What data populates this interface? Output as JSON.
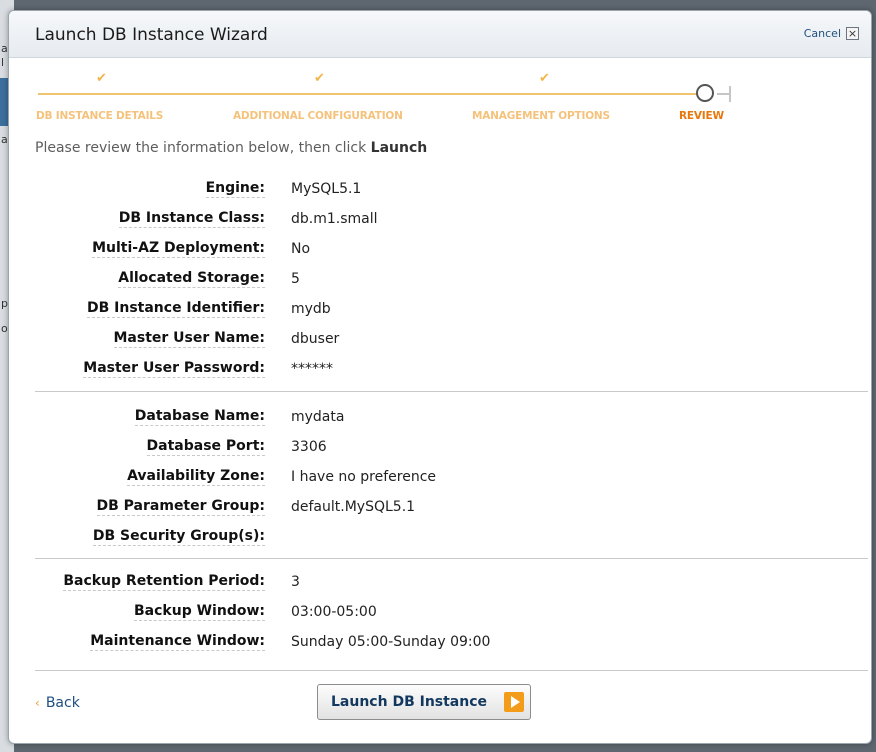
{
  "backdrop": {
    "fragments": [
      "a",
      "l",
      "a",
      "p",
      "o"
    ]
  },
  "dialog": {
    "title": "Launch DB Instance Wizard",
    "cancel_label": "Cancel",
    "close_glyph": "×"
  },
  "steps": [
    {
      "label": "DB INSTANCE DETAILS",
      "status": "done"
    },
    {
      "label": "ADDITIONAL CONFIGURATION",
      "status": "done"
    },
    {
      "label": "MANAGEMENT OPTIONS",
      "status": "done"
    },
    {
      "label": "REVIEW",
      "status": "current"
    }
  ],
  "step_check_glyph": "✔",
  "intro": {
    "text": "Please review the information below, then click ",
    "emphasis": "Launch"
  },
  "section1": [
    {
      "label": "Engine:",
      "value": "MySQL5.1"
    },
    {
      "label": "DB Instance Class:",
      "value": "db.m1.small"
    },
    {
      "label": "Multi-AZ Deployment:",
      "value": "No"
    },
    {
      "label": "Allocated Storage:",
      "value": "5"
    },
    {
      "label": "DB Instance Identifier:",
      "value": "mydb"
    },
    {
      "label": "Master User Name:",
      "value": "dbuser"
    },
    {
      "label": "Master User Password:",
      "value": "******"
    }
  ],
  "section2": [
    {
      "label": "Database Name:",
      "value": "mydata"
    },
    {
      "label": "Database Port:",
      "value": "3306"
    },
    {
      "label": "Availability Zone:",
      "value": "I have no preference"
    },
    {
      "label": "DB Parameter Group:",
      "value": "default.MySQL5.1"
    },
    {
      "label": "DB Security Group(s):",
      "value": ""
    }
  ],
  "section3": [
    {
      "label": "Backup Retention Period:",
      "value": "3"
    },
    {
      "label": "Backup Window:",
      "value": "03:00-05:00"
    },
    {
      "label": "Maintenance Window:",
      "value": "Sunday 05:00-Sunday 09:00"
    }
  ],
  "footer": {
    "back_glyph": "‹",
    "back_label": "Back",
    "launch_label": "Launch DB Instance"
  },
  "colors": {
    "step_done": "#f5c27c",
    "step_current": "#e8770c",
    "link": "#1f4f80",
    "accent": "#f39c1a"
  }
}
